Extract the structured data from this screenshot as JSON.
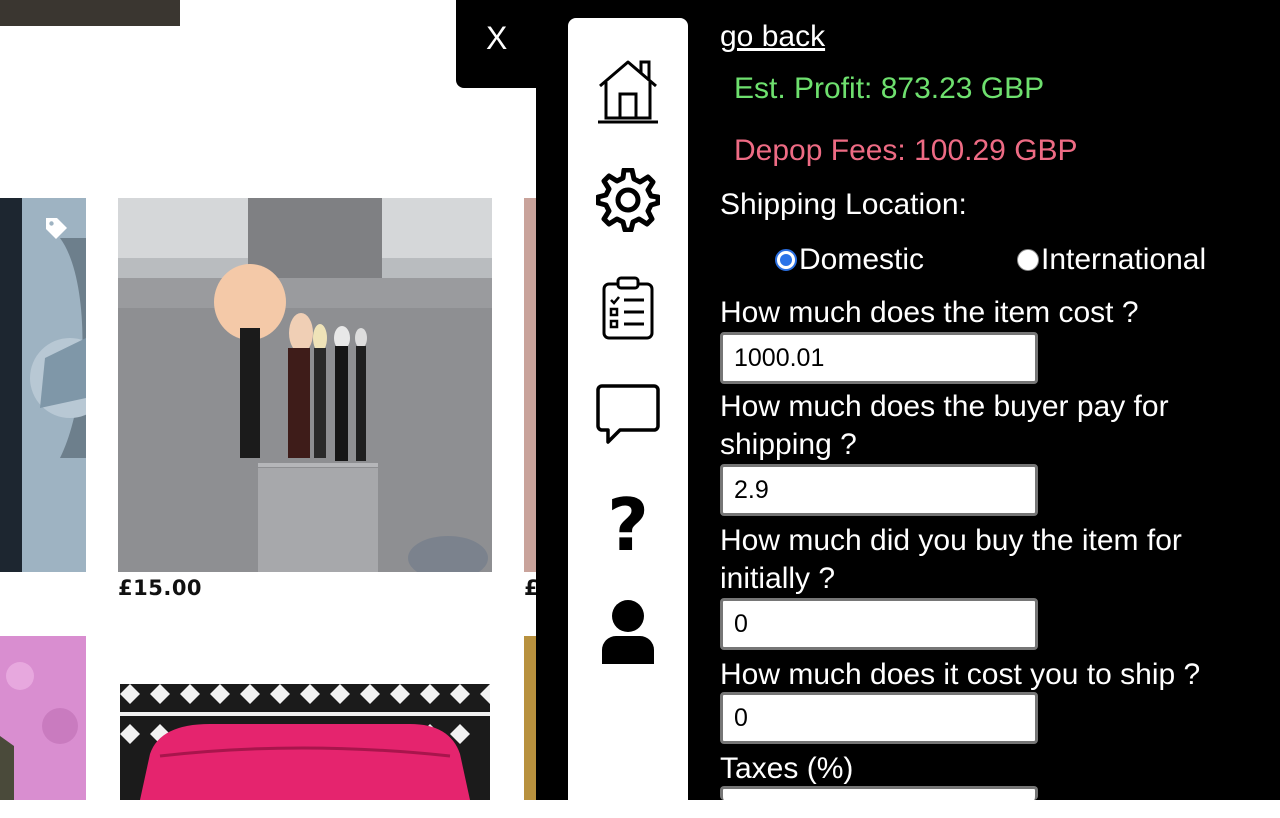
{
  "listings": [
    {
      "price": "£15.00"
    },
    {
      "price": "£"
    }
  ],
  "overlay": {
    "close_label": "X",
    "nav": [
      {
        "name": "home-icon"
      },
      {
        "name": "gear-icon"
      },
      {
        "name": "clipboard-list-icon"
      },
      {
        "name": "chat-bubble-icon"
      },
      {
        "name": "question-mark-icon"
      },
      {
        "name": "user-icon"
      }
    ]
  },
  "calculator": {
    "go_back": "go back",
    "profit": "Est. Profit: 873.23 GBP",
    "fees": "Depop Fees: 100.29 GBP",
    "shipping_location_label": "Shipping Location:",
    "shipping_options": [
      {
        "label": "Domestic",
        "selected": true
      },
      {
        "label": "International",
        "selected": false
      }
    ],
    "questions": [
      {
        "label": "How much does the item cost ?",
        "value": "1000.01"
      },
      {
        "label": "How much does the buyer pay for shipping ?",
        "value": "2.9"
      },
      {
        "label": "How much did you buy the item for initially ?",
        "value": "0"
      },
      {
        "label": "How much does it cost you to ship ?",
        "value": "0"
      },
      {
        "label": "Taxes (%)",
        "value": ""
      }
    ]
  },
  "colors": {
    "profit": "#6ee06e",
    "fees": "#ee6b84",
    "panel_bg": "#000000",
    "radio_accent": "#2b73e8"
  }
}
